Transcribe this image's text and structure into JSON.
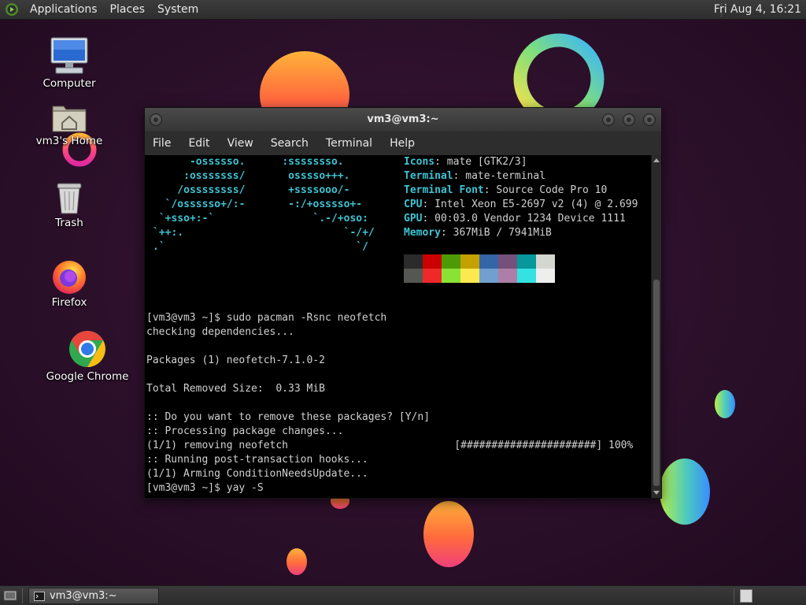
{
  "top_panel": {
    "menus": [
      "Applications",
      "Places",
      "System"
    ],
    "clock": "Fri Aug  4, 16:21"
  },
  "desktop_icons": [
    {
      "label": "Computer",
      "icon": "computer-icon"
    },
    {
      "label": "vm3's Home",
      "icon": "home-folder-icon"
    },
    {
      "label": "Trash",
      "icon": "trash-icon"
    },
    {
      "label": "Firefox",
      "icon": "firefox-icon"
    },
    {
      "label": "Google Chrome",
      "icon": "chrome-icon"
    }
  ],
  "terminal": {
    "title": "vm3@vm3:~",
    "menu": [
      "File",
      "Edit",
      "View",
      "Search",
      "Terminal",
      "Help"
    ],
    "ascii_art": [
      "      -ossssso.      :ssssssso.",
      "     :osssssss/       osssso+++.",
      "    /ossssssss/       +ssssooo/-",
      "  `/ossssso+/:-       -:/+osssso+-",
      " `+sso+:-`                `.-/+oso:",
      "`++:.                          `-/+/",
      ".`                               `/"
    ],
    "info": [
      {
        "key": "Icons",
        "value": ": mate [GTK2/3]"
      },
      {
        "key": "Terminal",
        "value": ": mate-terminal"
      },
      {
        "key": "Terminal Font",
        "value": ": Source Code Pro 10"
      },
      {
        "key": "CPU",
        "value": ": Intel Xeon E5-2697 v2 (4) @ 2.699"
      },
      {
        "key": "GPU",
        "value": ": 00:03.0 Vendor 1234 Device 1111"
      },
      {
        "key": "Memory",
        "value": ": 367MiB / 7941MiB"
      }
    ],
    "palette_top": [
      "#2b2b2b",
      "#cc0000",
      "#4e9a06",
      "#c4a000",
      "#3465a4",
      "#75507b",
      "#06989a",
      "#d3d7cf"
    ],
    "palette_bottom": [
      "#555753",
      "#ef2929",
      "#8ae234",
      "#fce94f",
      "#729fcf",
      "#ad7fa8",
      "#34e2e2",
      "#eeeeec"
    ],
    "lines": [
      "[vm3@vm3 ~]$ sudo pacman -Rsnc neofetch",
      "checking dependencies...",
      "",
      "Packages (1) neofetch-7.1.0-2",
      "",
      "Total Removed Size:  0.33 MiB",
      "",
      ":: Do you want to remove these packages? [Y/n]",
      ":: Processing package changes...",
      "(1/1) removing neofetch                           [######################] 100%",
      ":: Running post-transaction hooks...",
      "(1/1) Arming ConditionNeedsUpdate...",
      "[vm3@vm3 ~]$ yay -S"
    ]
  },
  "bottom_panel": {
    "task_label": "vm3@vm3:~"
  }
}
